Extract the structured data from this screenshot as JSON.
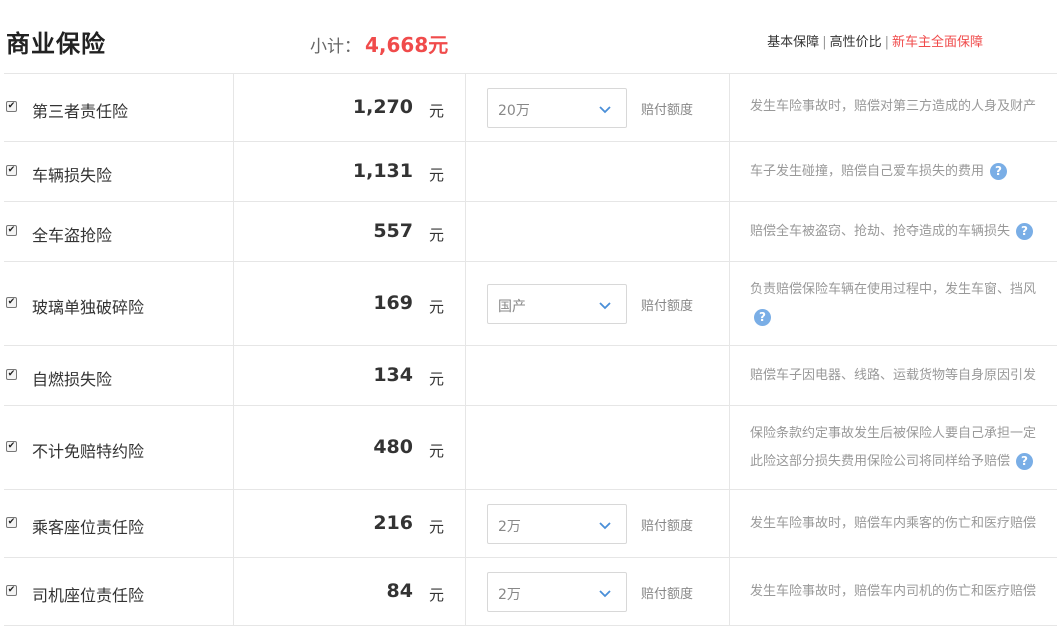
{
  "header": {
    "title": "商业保险",
    "subtotal_label": "小计：",
    "subtotal_value": "4,668元",
    "plans": [
      "基本保障",
      "高性价比",
      "新车主全面保障"
    ],
    "separator": "|"
  },
  "unit": "元",
  "option_label": "赔付额度",
  "help_glyph": "?",
  "check_glyph": "✔",
  "rows": [
    {
      "name": "第三者责任险",
      "price": "1,270",
      "checked": true,
      "option": "20万",
      "desc1": "发生车险事故时，赔偿对第三方造成的人身及财产",
      "desc2": ""
    },
    {
      "name": "车辆损失险",
      "price": "1,131",
      "checked": true,
      "option": "",
      "desc1": "车子发生碰撞，赔偿自己爱车损失的费用",
      "desc2": ""
    },
    {
      "name": "全车盗抢险",
      "price": "557",
      "checked": true,
      "option": "",
      "desc1": "赔偿全车被盗窃、抢劫、抢夺造成的车辆损失",
      "desc2": ""
    },
    {
      "name": "玻璃单独破碎险",
      "price": "169",
      "checked": true,
      "option": "国产",
      "desc1": "负责赔偿保险车辆在使用过程中，发生车窗、挡风",
      "desc2": ""
    },
    {
      "name": "自燃损失险",
      "price": "134",
      "checked": true,
      "option": "",
      "desc1": "赔偿车子因电器、线路、运载货物等自身原因引发",
      "desc2": ""
    },
    {
      "name": "不计免赔特约险",
      "price": "480",
      "checked": true,
      "option": "",
      "desc1": "保险条款约定事故发生后被保险人要自己承担一定",
      "desc2": "此险这部分损失费用保险公司将同样给予赔偿"
    },
    {
      "name": "乘客座位责任险",
      "price": "216",
      "checked": true,
      "option": "2万",
      "desc1": "发生车险事故时，赔偿车内乘客的伤亡和医疗赔偿",
      "desc2": ""
    },
    {
      "name": "司机座位责任险",
      "price": "84",
      "checked": true,
      "option": "2万",
      "desc1": "发生车险事故时，赔偿车内司机的伤亡和医疗赔偿",
      "desc2": ""
    }
  ],
  "colors": {
    "accent_red": "#f04b4b",
    "help_blue": "#7aaee6",
    "border": "#e6e6e6"
  }
}
